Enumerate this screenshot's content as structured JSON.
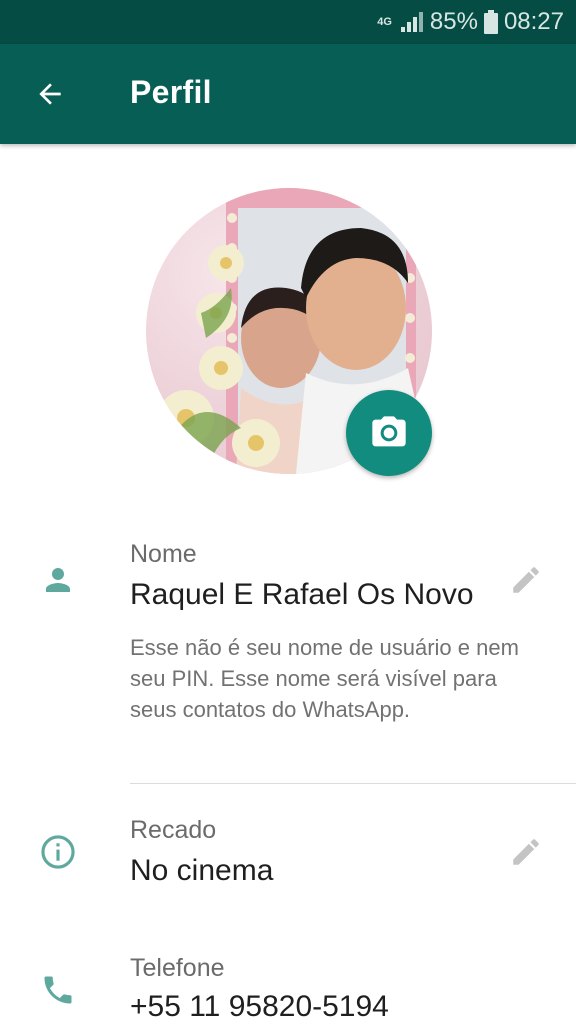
{
  "status_bar": {
    "network": "4G",
    "battery": "85%",
    "time": "08:27"
  },
  "app_bar": {
    "title": "Perfil",
    "back_icon": "arrow-back-icon"
  },
  "profile": {
    "photo_icon": "camera-icon"
  },
  "name_section": {
    "icon": "person-icon",
    "label": "Nome",
    "value": "Raquel E Rafael Os Novo",
    "hint": "Esse não é seu nome de usuário e nem seu PIN. Esse nome será visível para seus contatos do WhatsApp.",
    "edit_icon": "pencil-icon"
  },
  "about_section": {
    "icon": "info-icon",
    "label": "Recado",
    "value": "No cinema",
    "edit_icon": "pencil-icon"
  },
  "phone_section": {
    "icon": "phone-icon",
    "label": "Telefone",
    "value": "+55 11 95820-5194"
  },
  "colors": {
    "status_bar": "#054d44",
    "app_bar": "#075e54",
    "accent": "#128c7e",
    "icon_teal": "#5fa89e"
  }
}
